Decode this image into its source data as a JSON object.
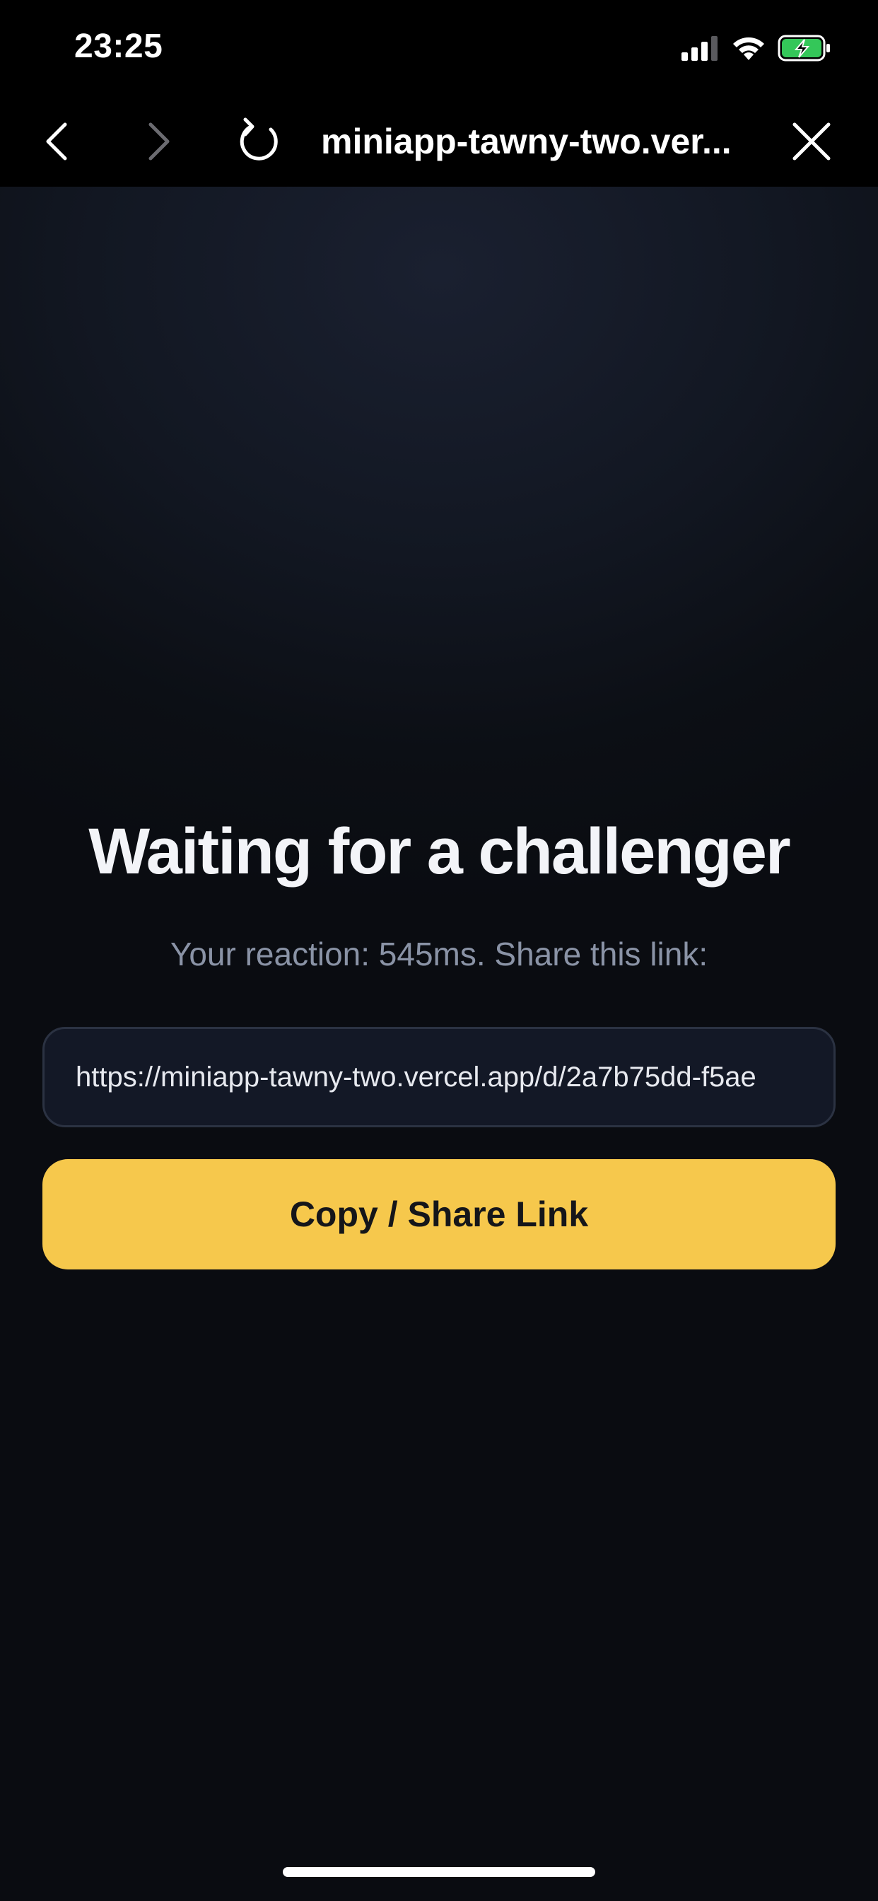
{
  "status_bar": {
    "time": "23:25",
    "icons": [
      "cellular-signal-icon",
      "wifi-icon",
      "battery-charging-icon"
    ],
    "battery_color": "#34c759"
  },
  "browser": {
    "title": "miniapp-tawny-two.ver...",
    "icons": [
      "chevron-left-icon",
      "chevron-right-icon",
      "reload-icon",
      "close-icon"
    ]
  },
  "main": {
    "headline": "Waiting for a challenger",
    "subline": "Your reaction: 545ms. Share this link:",
    "link_value": "https://miniapp-tawny-two.vercel.app/d/2a7b75dd-f5ae",
    "share_button_label": "Copy / Share Link"
  },
  "colors": {
    "accent": "#f6c84c",
    "background": "#0b0d12",
    "input_background": "#131826",
    "muted_text": "#8a93a6"
  }
}
